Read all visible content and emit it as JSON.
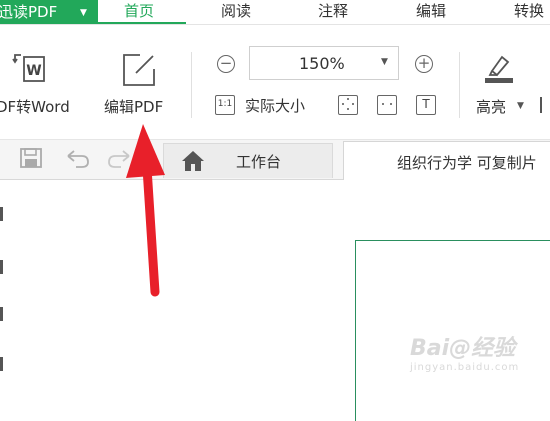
{
  "menubar": {
    "app_title": "迅读PDF",
    "items": [
      {
        "label": "首页",
        "active": true
      },
      {
        "label": "阅读",
        "active": false
      },
      {
        "label": "注释",
        "active": false
      },
      {
        "label": "编辑",
        "active": false
      },
      {
        "label": "转换",
        "active": false
      }
    ]
  },
  "ribbon": {
    "pdf_to_word_label": "DF转Word",
    "edit_pdf_label": "编辑PDF",
    "zoom_value": "150%",
    "actual_size_label": "实际大小",
    "actual_size_icon_text": "1:1",
    "fit_page_text": "T",
    "highlight_label": "高亮",
    "pdf_icon_letter": "W"
  },
  "tabs": {
    "home_label": "工作台",
    "document_label": "组织行为学 可复制片"
  },
  "watermark": {
    "brand": "Bai@经验",
    "url": "jingyan.baidu.com"
  },
  "colors": {
    "brand_green": "#22a85a",
    "annotation_arrow": "#e8202a"
  }
}
